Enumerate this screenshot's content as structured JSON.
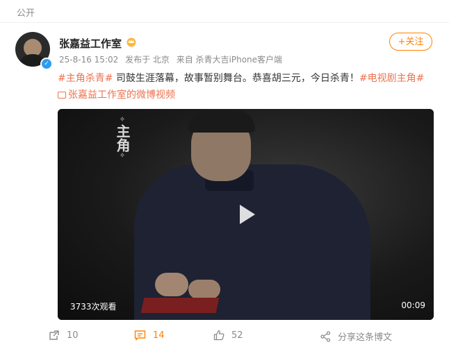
{
  "visibility": "公开",
  "post": {
    "author": "张嘉益工作室",
    "follow_label": "+关注",
    "time": "25-8-16 15:02",
    "location": "发布于 北京",
    "source": "来自 杀青大吉iPhone客户端",
    "text": {
      "tag1": "#主角杀青#",
      "body": " 司鼓生涯落幕，故事暂别舞台。恭喜胡三元，今日杀青！",
      "tag2": "#电视剧主角#",
      "video_link": "张嘉益工作室的微博视频"
    },
    "video": {
      "logo": "主角",
      "views": "3733次观看",
      "duration": "00:09"
    },
    "actions": {
      "repost_count": "10",
      "comment_count": "14",
      "like_count": "52",
      "share_label": "分享这条博文"
    }
  },
  "colors": {
    "accent": "#ff8200",
    "tag": "#eb7350",
    "verified": "#2d9cf0"
  },
  "icons": [
    "verified-icon",
    "crown-icon",
    "video-icon",
    "play-icon",
    "repost-icon",
    "comment-icon",
    "like-icon",
    "share-icon"
  ]
}
